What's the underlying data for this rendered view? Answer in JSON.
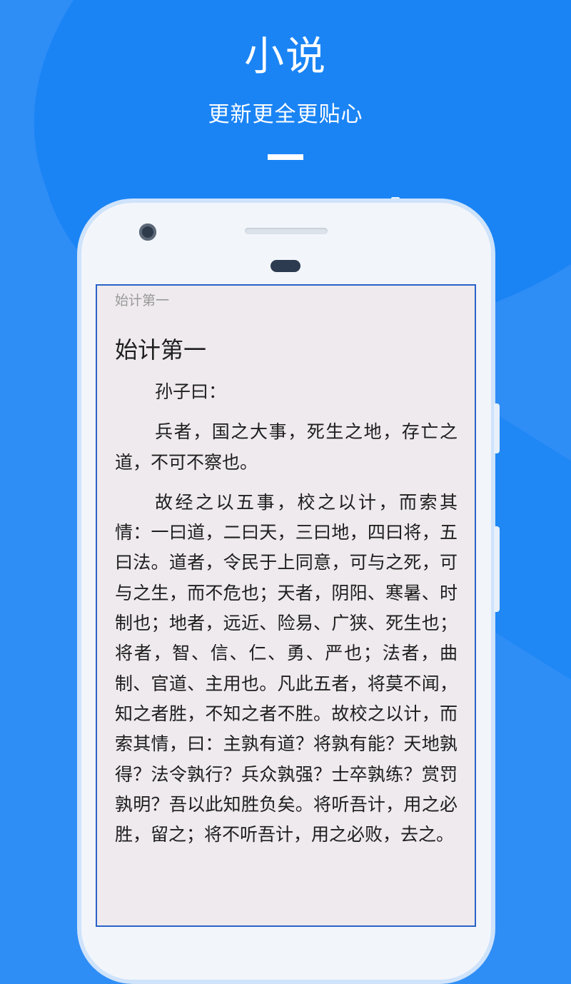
{
  "hero": {
    "title": "小说",
    "subtitle": "更新更全更贴心"
  },
  "reader": {
    "header_chapter": "始计第一",
    "chapter_title": "始计第一",
    "paragraphs": [
      "孙子曰：",
      "兵者，国之大事，死生之地，存亡之道，不可不察也。",
      "故经之以五事，校之以计，而索其情：一曰道，二曰天，三曰地，四曰将，五曰法。道者，令民于上同意，可与之死，可与之生，而不危也；天者，阴阳、寒暑、时制也；地者，远近、险易、广狭、死生也；将者，智、信、仁、勇、严也；法者，曲制、官道、主用也。凡此五者，将莫不闻，知之者胜，不知之者不胜。故校之以计，而索其情，曰：主孰有道？将孰有能？天地孰得？法令孰行？兵众孰强？士卒孰练？赏罚孰明？吾以此知胜负矣。将听吾计，用之必胜，留之；将不听吾计，用之必败，去之。"
    ]
  },
  "colors": {
    "background": "#2f8df6",
    "screen_border": "#2a62c9",
    "page_background": "#efeaed"
  }
}
